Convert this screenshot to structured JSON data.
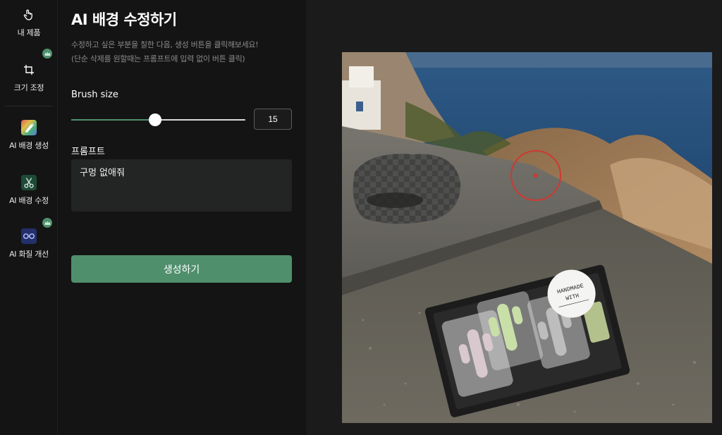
{
  "sidebar": {
    "items": [
      {
        "label": "내 제품",
        "icon": "hand-pointer-icon"
      },
      {
        "label": "크기 조정",
        "icon": "crop-icon",
        "premium": true
      },
      {
        "label": "AI 배경 생성",
        "icon": "ai-background-generate-icon"
      },
      {
        "label": "AI 배경 수정",
        "icon": "scissors-icon"
      },
      {
        "label": "AI 화질 개선",
        "icon": "enhance-quality-icon",
        "premium": true
      }
    ]
  },
  "panel": {
    "title": "AI 배경 수정하기",
    "desc_line1": "수정하고 싶은 부분을 칠한 다음, 생성 버튼을 클릭해보세요!",
    "desc_line2": "(단순 삭제를 원할때는 프롬프트에 입력 없이 버튼 클릭)",
    "brush_label": "Brush size",
    "brush_value": "15",
    "brush_fraction": 0.48,
    "prompt_label": "프롬프트",
    "prompt_value": "구멍 없애줘",
    "generate_label": "생성하기"
  },
  "colors": {
    "accent": "#4f8f6c",
    "background": "#141414",
    "brush_cursor": "#cc3a32"
  }
}
